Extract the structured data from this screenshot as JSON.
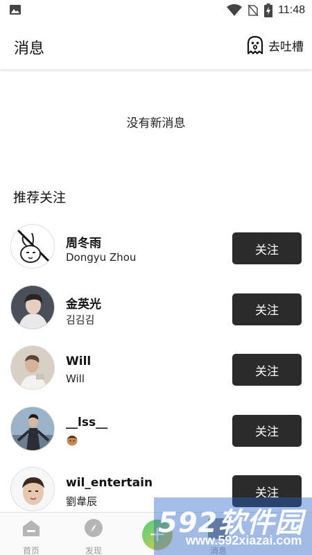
{
  "status_bar": {
    "time": "11:48",
    "icons": [
      "image-icon",
      "wifi-icon",
      "no-sim-icon",
      "battery-charging-icon"
    ]
  },
  "header": {
    "title": "消息",
    "feedback_label": "去吐槽",
    "feedback_icon": "ghost-icon"
  },
  "empty_message": "没有新消息",
  "recommend": {
    "title": "推荐关注",
    "follow_label": "关注",
    "users": [
      {
        "name": "周冬雨",
        "subtitle": "Dongyu Zhou"
      },
      {
        "name": "金英光",
        "subtitle": "김김김"
      },
      {
        "name": "Will",
        "subtitle": "Will"
      },
      {
        "name": "__lss__",
        "subtitle": ""
      },
      {
        "name": "wil_entertain",
        "subtitle": "劉韋辰"
      }
    ]
  },
  "bottom_nav": {
    "items": [
      {
        "label": "首页",
        "icon": "home-icon"
      },
      {
        "label": "发现",
        "icon": "compass-icon"
      },
      {
        "label": "",
        "icon": "add-icon"
      },
      {
        "label": "消息",
        "icon": "message-icon"
      }
    ]
  },
  "watermark": {
    "brand": "592软件园",
    "url": "www.592xiazai.com"
  },
  "colors": {
    "button_bg": "#2b2b2b",
    "nav_text": "#9a9a9a",
    "watermark": "#2864c8"
  }
}
